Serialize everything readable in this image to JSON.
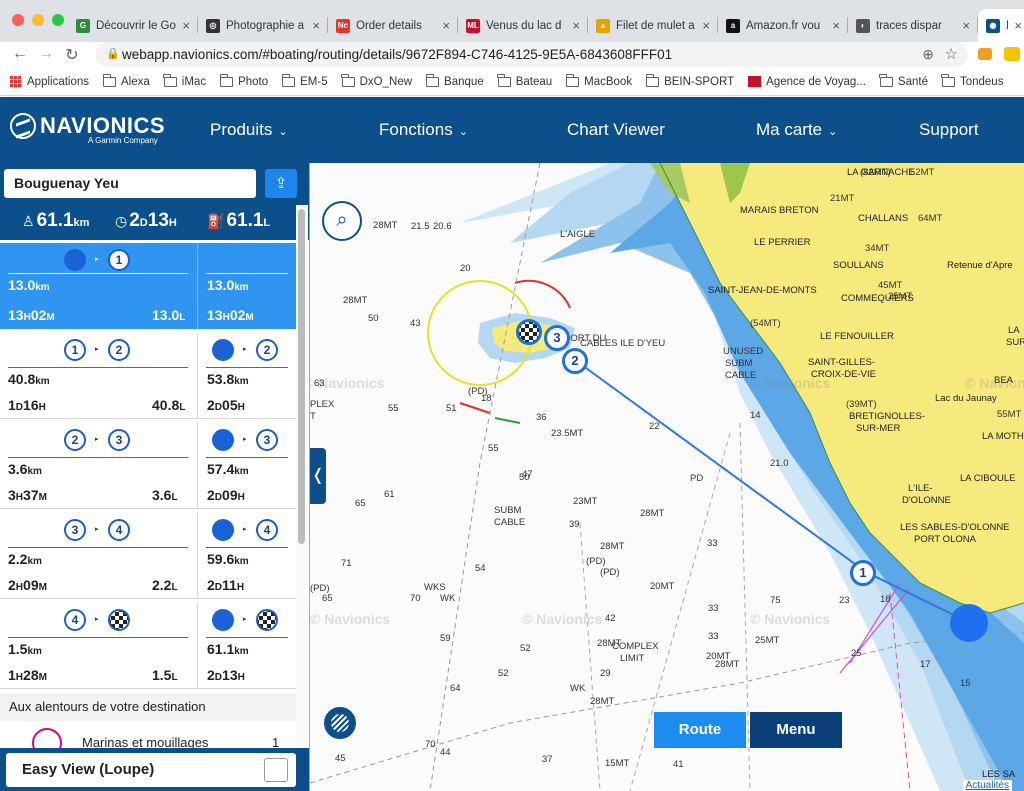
{
  "browser": {
    "tabs": [
      {
        "title": "Découvrir le Go",
        "fav": "G",
        "fav_color": "#2e8b3a"
      },
      {
        "title": "Photographie a",
        "fav": "◎",
        "fav_color": "#333333"
      },
      {
        "title": "Order details",
        "fav": "Nc",
        "fav_color": "#e2372b"
      },
      {
        "title": "Venus du lac d",
        "fav": "ML",
        "fav_color": "#c8102e"
      },
      {
        "title": "Filet de mulet a",
        "fav": "▲",
        "fav_color": "#e9a400"
      },
      {
        "title": "Amazon.fr vou",
        "fav": "a",
        "fav_color": "#111111"
      },
      {
        "title": "traces dispar",
        "fav": "◐",
        "fav_color": "#555555"
      },
      {
        "title": "Na",
        "fav": "◉",
        "fav_color": "#0b4f8b"
      }
    ],
    "url": "webapp.navionics.com/#boating/routing/details/9672F894-C746-4125-9E5A-6843608FFF01",
    "bookmarks": [
      "Applications",
      "Alexa",
      "iMac",
      "Photo",
      "EM-5",
      "DxO_New",
      "Banque",
      "Bateau",
      "MacBook",
      "BEIN-SPORT",
      "Agence de Voyag...",
      "Santé",
      "Tondeus"
    ]
  },
  "header": {
    "brand": "NAVIONICS",
    "brand_sub": "A Garmin Company",
    "menu": {
      "produits": "Produits",
      "fonctions": "Fonctions",
      "chart_viewer": "Chart Viewer",
      "ma_carte": "Ma carte",
      "support": "Support"
    }
  },
  "panel": {
    "route_name": "Bouguenay Yeu",
    "stats": {
      "distance": "61.1",
      "distance_unit": "km",
      "duration_d": "2",
      "duration_d_unit": "D",
      "duration_h": "13",
      "duration_h_unit": "H",
      "fuel": "61.1",
      "fuel_unit": "L"
    },
    "legs": [
      {
        "from": "",
        "to": "1",
        "dist": "13.0",
        "dist_unit": "km",
        "time_a": "13",
        "time_a_unit": "H",
        "time_b": "02",
        "time_b_unit": "M",
        "fuel": "13.0",
        "fuel_unit": "L",
        "cum_from": "",
        "cum_to": "",
        "cum_dist": "13.0",
        "cum_dist_unit": "km",
        "cum_a": "13",
        "cum_a_unit": "H",
        "cum_b": "02",
        "cum_b_unit": "M"
      },
      {
        "from": "1",
        "to": "2",
        "dist": "40.8",
        "dist_unit": "km",
        "time_a": "1",
        "time_a_unit": "D",
        "time_b": "16",
        "time_b_unit": "H",
        "fuel": "40.8",
        "fuel_unit": "L",
        "cum_from": "",
        "cum_to": "2",
        "cum_dist": "53.8",
        "cum_dist_unit": "km",
        "cum_a": "2",
        "cum_a_unit": "D",
        "cum_b": "05",
        "cum_b_unit": "H"
      },
      {
        "from": "2",
        "to": "3",
        "dist": "3.6",
        "dist_unit": "km",
        "time_a": "3",
        "time_a_unit": "H",
        "time_b": "37",
        "time_b_unit": "M",
        "fuel": "3.6",
        "fuel_unit": "L",
        "cum_from": "",
        "cum_to": "3",
        "cum_dist": "57.4",
        "cum_dist_unit": "km",
        "cum_a": "2",
        "cum_a_unit": "D",
        "cum_b": "09",
        "cum_b_unit": "H"
      },
      {
        "from": "3",
        "to": "4",
        "dist": "2.2",
        "dist_unit": "km",
        "time_a": "2",
        "time_a_unit": "H",
        "time_b": "09",
        "time_b_unit": "M",
        "fuel": "2.2",
        "fuel_unit": "L",
        "cum_from": "",
        "cum_to": "4",
        "cum_dist": "59.6",
        "cum_dist_unit": "km",
        "cum_a": "2",
        "cum_a_unit": "D",
        "cum_b": "11",
        "cum_b_unit": "H"
      },
      {
        "from": "4",
        "to": "",
        "dist": "1.5",
        "dist_unit": "km",
        "time_a": "1",
        "time_a_unit": "H",
        "time_b": "28",
        "time_b_unit": "M",
        "fuel": "1.5",
        "fuel_unit": "L",
        "cum_from": "",
        "cum_to": "",
        "cum_dist": "61.1",
        "cum_dist_unit": "km",
        "cum_a": "2",
        "cum_a_unit": "D",
        "cum_b": "13",
        "cum_b_unit": "H"
      }
    ],
    "around_title": "Aux alentours de votre destination",
    "marina_label": "Marinas et mouillages",
    "marina_count": "1",
    "easy_view": "Easy View (Loupe)"
  },
  "map": {
    "route_button": "Route",
    "menu_button": "Menu",
    "updates_link": "Actualités",
    "watermark": "© Navionics",
    "waypoints": [
      "1",
      "2",
      "3"
    ],
    "place_labels": {
      "la_garnache": "LA GARNACHE",
      "marais_breton": "MARAIS BRETON",
      "challans": "CHALLANS",
      "le_perrier": "LE PERRIER",
      "soullans": "SOULLANS",
      "retenue": "Retenue d'Apre",
      "st_jean": "SAINT-JEAN-DE-MONTS",
      "commequiers": "COMMEQUIERS",
      "le_fenouiller": "LE FENOUILLER",
      "st_gilles": "SAINT-GILLES-",
      "croix_de_vie": "CROIX-DE-VIE",
      "lac_jaunay": "Lac du Jaunay",
      "bretignolles": "BRETIGNOLLES-",
      "sur_mer": "SUR-MER",
      "la_mothe": "LA MOTH",
      "la_ciboule": "LA CIBOULE",
      "lile_dolonne": "L'ILE-",
      "dolonne": "D'OLONNE",
      "sables": "LES SABLES-D'OLONNE",
      "port_olona": "PORT OLONA",
      "complex_limit": "COMPLEX",
      "limit": "LIMIT",
      "complex_left": "PLEX",
      "complex_left2": "T",
      "subm_cable": "SUBM",
      "cable": "CABLE",
      "unused_subm": "UNUSED",
      "unused_subm2": "SUBM",
      "unused_subm3": "CABLE",
      "lagie": "L'AIGLE",
      "port_du_bec": "PORT DU",
      "cables_ile": "CABLES ILE D'YEU",
      "les_sables": "LES SA",
      "bea": "BEA",
      "sur": "SUR",
      "la": "LA"
    },
    "depths": [
      "28MT",
      "21.5",
      "20.6",
      "20",
      "43",
      "28MT",
      "50",
      "63",
      "55",
      "51",
      "18",
      "36",
      "23.5MT",
      "55",
      "47",
      "65",
      "61",
      "71",
      "65",
      "70",
      "59",
      "52",
      "64",
      "52",
      "44",
      "70",
      "45",
      "75",
      "22",
      "21.0",
      "50",
      "23MT",
      "39",
      "28MT",
      "28MT",
      "(PD)",
      "WKS",
      "WK",
      "54",
      "42",
      "20MT",
      "33",
      "33",
      "25MT",
      "28MT",
      "20MT",
      "28MT",
      "29",
      "23",
      "25",
      "14",
      "17",
      "15",
      "18",
      "33",
      "WK",
      "28MT",
      "15MT",
      "41",
      "37",
      "(82MT)",
      "52MT",
      "21MT",
      "64MT",
      "34MT",
      "45MT",
      "25MT",
      "(54MT)",
      "(39MT)",
      "55MT",
      "(PD)",
      "PD",
      "(PD)",
      "(PD)"
    ]
  }
}
